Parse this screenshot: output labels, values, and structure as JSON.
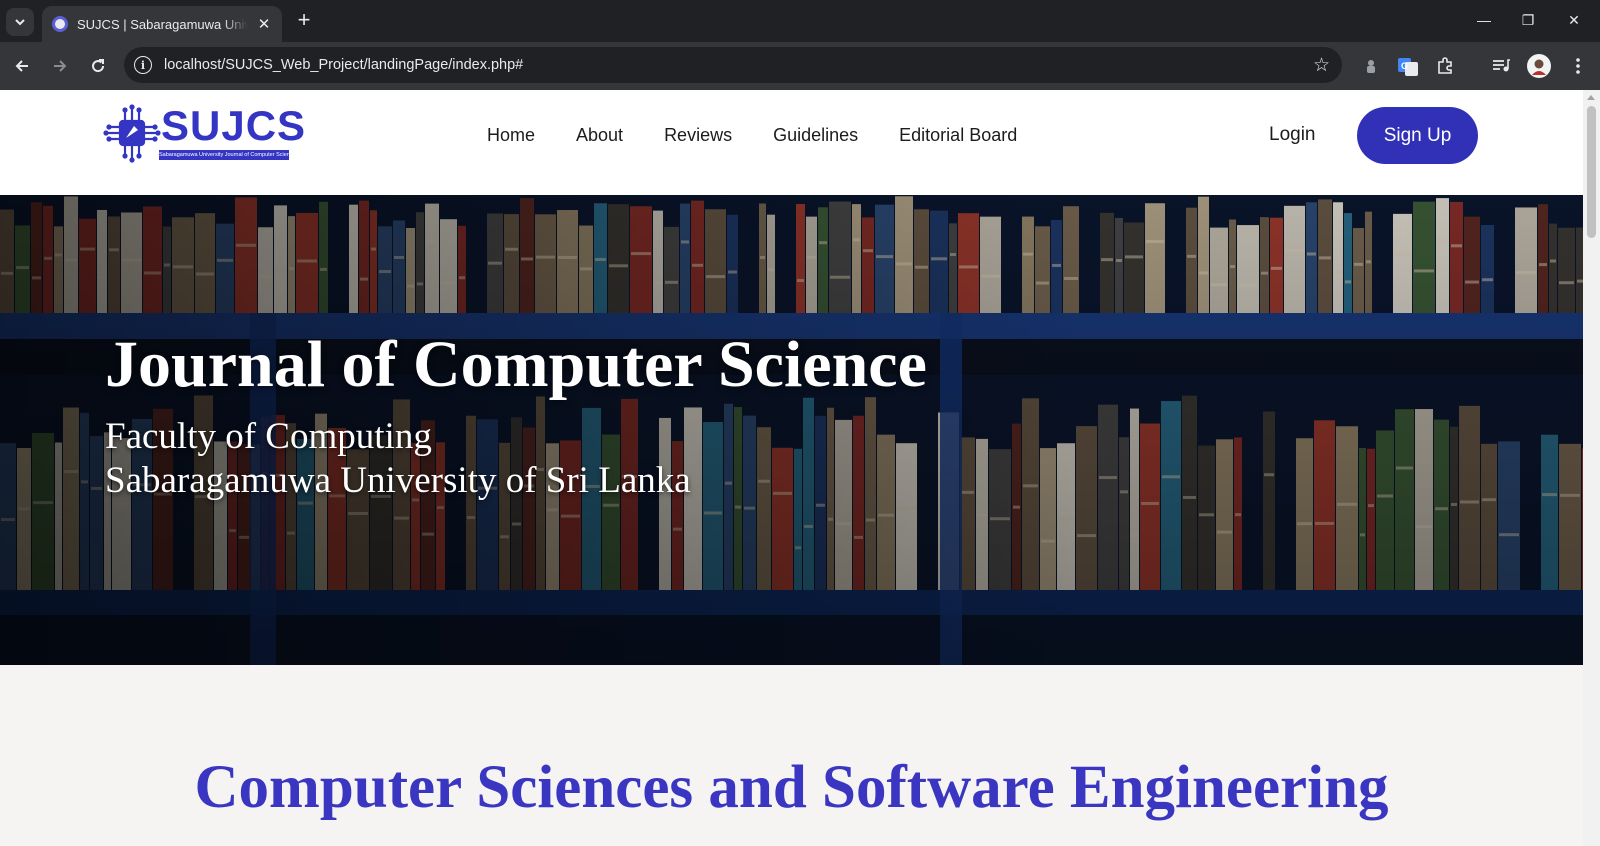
{
  "browser": {
    "tab_title": "SUJCS | Sabaragamuwa University Journal of Computer Science",
    "tab_close": "✕",
    "new_tab": "+",
    "url": "localhost/SUJCS_Web_Project/landingPage/index.php#",
    "window_controls": [
      "—",
      "❐",
      "✕"
    ]
  },
  "header": {
    "logo_text": "SUJCS",
    "logo_tagline": "Sabaragamuwa University Journal of Computer Science",
    "nav": [
      {
        "label": "Home"
      },
      {
        "label": "About"
      },
      {
        "label": "Reviews"
      },
      {
        "label": "Guidelines"
      },
      {
        "label": "Editorial Board"
      }
    ],
    "login_label": "Login",
    "signup_label": "Sign Up"
  },
  "hero": {
    "title": "Journal of Computer Science",
    "subtitle_line1": "Faculty of Computing",
    "subtitle_line2": "Sabaragamuwa University of Sri Lanka"
  },
  "section": {
    "title": "Computer Sciences and Software Engineering"
  },
  "colors": {
    "brand": "#3535c4",
    "signup_bg": "#3131b8",
    "section_title": "#3a36c2",
    "page_bg": "#f5f4f2",
    "chrome_dark": "#202124",
    "chrome_toolbar": "#35363a"
  },
  "icons": [
    "chevron-down-icon",
    "favicon-icon",
    "close-icon",
    "plus-icon",
    "back-arrow-icon",
    "forward-arrow-icon",
    "reload-icon",
    "info-icon",
    "star-icon",
    "extension-icon",
    "translate-icon",
    "puzzle-icon",
    "media-icon",
    "profile-avatar-icon",
    "kebab-menu-icon",
    "minimize-icon",
    "restore-icon"
  ]
}
